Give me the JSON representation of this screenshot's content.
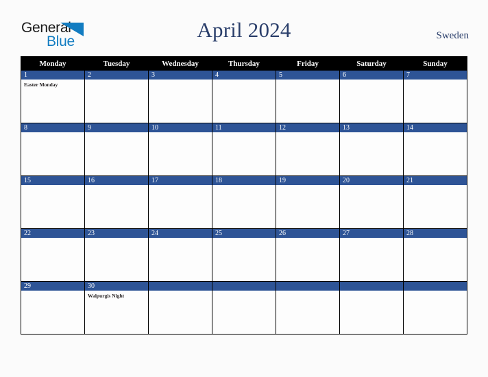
{
  "brand": {
    "name_part1": "General",
    "name_part2": "Blue",
    "triangle_icon": "blue-triangle-icon",
    "accent_color": "#127cc1"
  },
  "header": {
    "title": "April 2024",
    "country": "Sweden",
    "title_color": "#2b3f6b"
  },
  "calendar": {
    "month": "April",
    "year": "2024",
    "weekday_headers": [
      "Monday",
      "Tuesday",
      "Wednesday",
      "Thursday",
      "Friday",
      "Saturday",
      "Sunday"
    ],
    "header_bg": "#000000",
    "date_band_bg": "#2e5496",
    "cell_bg": "#fdfdfd",
    "grid_line": "#000000",
    "weeks": [
      [
        {
          "date": "1",
          "events": [
            "Easter Monday"
          ]
        },
        {
          "date": "2",
          "events": []
        },
        {
          "date": "3",
          "events": []
        },
        {
          "date": "4",
          "events": []
        },
        {
          "date": "5",
          "events": []
        },
        {
          "date": "6",
          "events": []
        },
        {
          "date": "7",
          "events": []
        }
      ],
      [
        {
          "date": "8",
          "events": []
        },
        {
          "date": "9",
          "events": []
        },
        {
          "date": "10",
          "events": []
        },
        {
          "date": "11",
          "events": []
        },
        {
          "date": "12",
          "events": []
        },
        {
          "date": "13",
          "events": []
        },
        {
          "date": "14",
          "events": []
        }
      ],
      [
        {
          "date": "15",
          "events": []
        },
        {
          "date": "16",
          "events": []
        },
        {
          "date": "17",
          "events": []
        },
        {
          "date": "18",
          "events": []
        },
        {
          "date": "19",
          "events": []
        },
        {
          "date": "20",
          "events": []
        },
        {
          "date": "21",
          "events": []
        }
      ],
      [
        {
          "date": "22",
          "events": []
        },
        {
          "date": "23",
          "events": []
        },
        {
          "date": "24",
          "events": []
        },
        {
          "date": "25",
          "events": []
        },
        {
          "date": "26",
          "events": []
        },
        {
          "date": "27",
          "events": []
        },
        {
          "date": "28",
          "events": []
        }
      ],
      [
        {
          "date": "29",
          "events": []
        },
        {
          "date": "30",
          "events": [
            "Walpurgis Night"
          ]
        },
        {
          "date": "",
          "events": []
        },
        {
          "date": "",
          "events": []
        },
        {
          "date": "",
          "events": []
        },
        {
          "date": "",
          "events": []
        },
        {
          "date": "",
          "events": []
        }
      ]
    ]
  }
}
